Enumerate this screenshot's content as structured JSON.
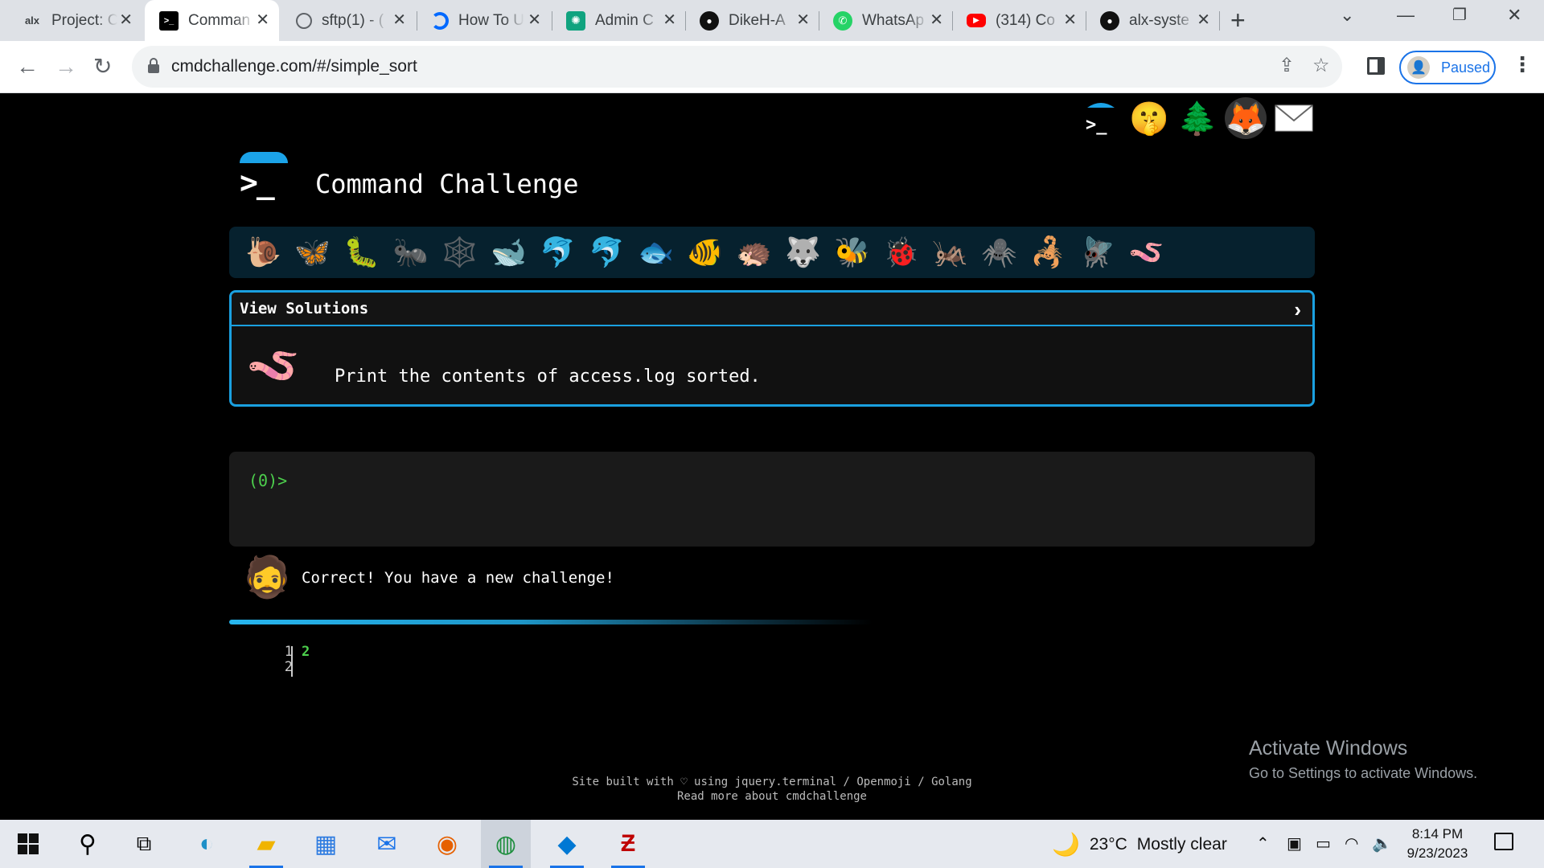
{
  "browser": {
    "tabs": [
      {
        "title": "Project: C",
        "favicon": "alx",
        "favicon_color": "#000000"
      },
      {
        "title": "Comman",
        "favicon": ">_",
        "favicon_color": "#000000",
        "active": true
      },
      {
        "title": "sftp(1) - (",
        "favicon": "globe",
        "favicon_color": "#5f6368"
      },
      {
        "title": "How To U",
        "favicon": "digitalocean",
        "favicon_color": "#0069ff"
      },
      {
        "title": "Admin C",
        "favicon": "chatgpt",
        "favicon_color": "#10a37f"
      },
      {
        "title": "DikeH-A",
        "favicon": "github",
        "favicon_color": "#000000"
      },
      {
        "title": "WhatsAp",
        "favicon": "whatsapp",
        "favicon_color": "#25d366"
      },
      {
        "title": "(314) Co",
        "favicon": "youtube",
        "favicon_color": "#ff0000"
      },
      {
        "title": "alx-syste",
        "favicon": "github",
        "favicon_color": "#000000"
      }
    ],
    "url": "cmdchallenge.com/#/simple_sort",
    "profile_label": "Paused"
  },
  "page": {
    "site_title": "Command Challenge",
    "logo_prompt": ">_",
    "top_icons": [
      "cmdchallenge-icon",
      "shushing-face-icon",
      "tree-icon",
      "gitlab-icon",
      "envelope-icon"
    ],
    "creatures": [
      "🐌",
      "🦋",
      "🐛",
      "🐜",
      "🕸️",
      "🐋",
      "🐬",
      "🐬",
      "🐟",
      "🐠",
      "🦔",
      "🐺",
      "🐝",
      "🐞",
      "🦗",
      "🕷️",
      "🦂",
      "🪰",
      "🪱"
    ],
    "view_solutions": "View Solutions",
    "task_text": "Print the contents of access.log sorted.",
    "terminal_prompt": "(0)>",
    "result_text": "Correct! You have a new challenge!",
    "output": {
      "line_numbers": [
        "1",
        "2"
      ],
      "lines": [
        "2"
      ]
    },
    "footer_line1": "Site built with ♡ using jquery.terminal / Openmoji / Golang",
    "footer_line2": "Read more about cmdchallenge",
    "activate_title": "Activate Windows",
    "activate_sub": "Go to Settings to activate Windows."
  },
  "taskbar": {
    "weather_temp": "23°C",
    "weather_desc": "Mostly clear",
    "time": "8:14 PM",
    "date": "9/23/2023"
  },
  "colors": {
    "accent": "#1aa0e0",
    "terminal_green": "#4dd04d",
    "creature_bar": "#06212e"
  }
}
